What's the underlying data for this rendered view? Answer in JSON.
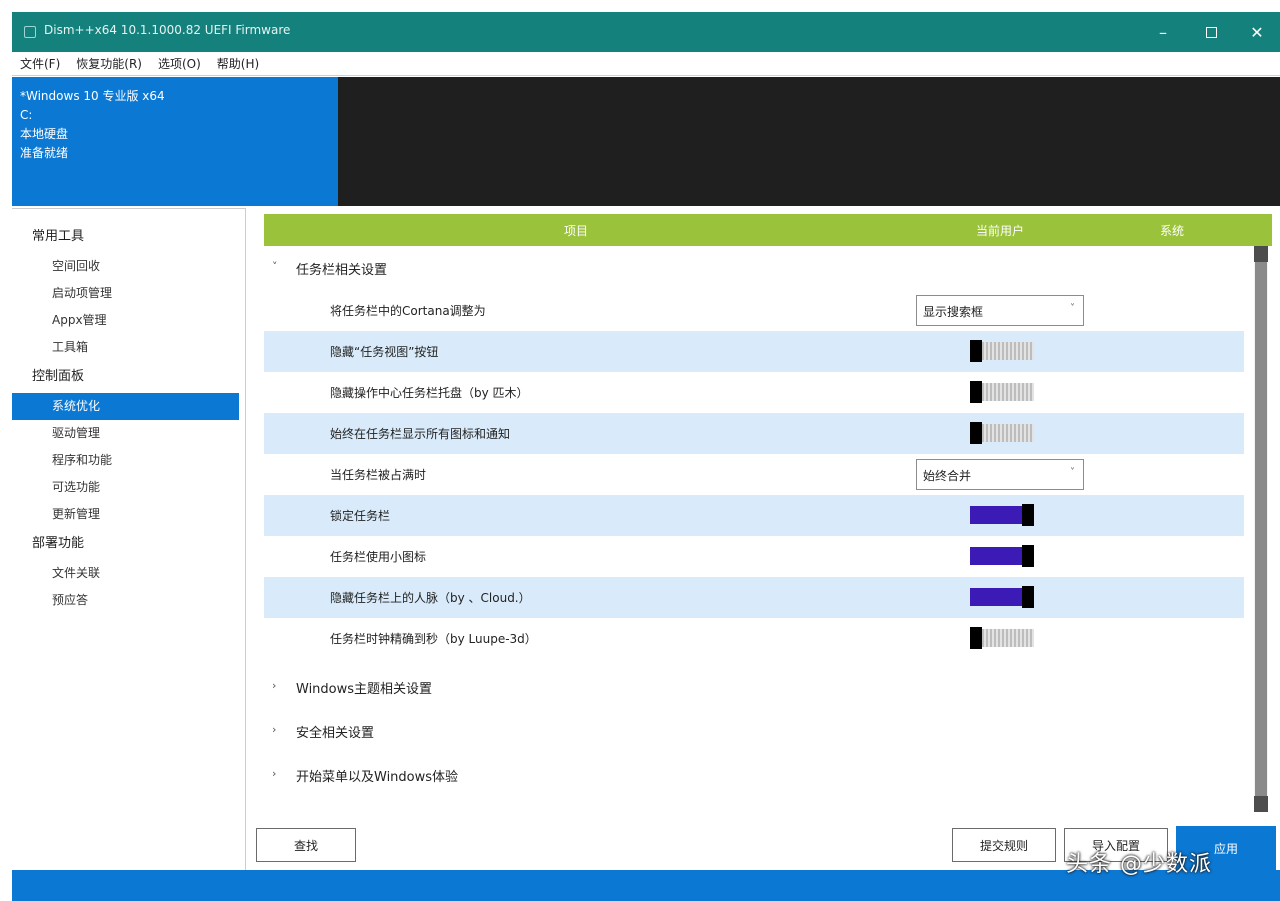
{
  "window": {
    "title": "Dism++x64 10.1.1000.82 UEFI Firmware",
    "minimize": "–",
    "close": "✕"
  },
  "menu": [
    "文件(F)",
    "恢复功能(R)",
    "选项(O)",
    "帮助(H)"
  ],
  "session": {
    "lines": [
      "*Windows 10 专业版 x64",
      "C:",
      "本地硬盘",
      "准备就绪"
    ]
  },
  "nav": [
    {
      "category": "常用工具",
      "items": [
        "空间回收",
        "启动项管理",
        "Appx管理",
        "工具箱"
      ]
    },
    {
      "category": "控制面板",
      "items": [
        "系统优化",
        "驱动管理",
        "程序和功能",
        "可选功能",
        "更新管理"
      ]
    },
    {
      "category": "部署功能",
      "items": [
        "文件关联",
        "预应答"
      ]
    }
  ],
  "nav_active": "系统优化",
  "table": {
    "headers": {
      "item": "项目",
      "current_user": "当前用户",
      "system": "系统"
    },
    "groups": [
      {
        "label": "任务栏相关设置",
        "expanded": true,
        "rows": [
          {
            "label": "将任务栏中的Cortana调整为",
            "control": "dropdown",
            "value": "显示搜索框"
          },
          {
            "label": "隐藏“任务视图”按钮",
            "control": "toggle",
            "state": "off"
          },
          {
            "label": "隐藏操作中心任务栏托盘（by 匹木）",
            "control": "toggle",
            "state": "off"
          },
          {
            "label": "始终在任务栏显示所有图标和通知",
            "control": "toggle",
            "state": "off"
          },
          {
            "label": "当任务栏被占满时",
            "control": "dropdown",
            "value": "始终合并"
          },
          {
            "label": "锁定任务栏",
            "control": "toggle",
            "state": "on"
          },
          {
            "label": "任务栏使用小图标",
            "control": "toggle",
            "state": "on"
          },
          {
            "label": "隐藏任务栏上的人脉（by 、Cloud.）",
            "control": "toggle",
            "state": "on"
          },
          {
            "label": "任务栏时钟精确到秒（by Luupe-3d）",
            "control": "toggle",
            "state": "off"
          }
        ]
      },
      {
        "label": "Windows主题相关设置",
        "expanded": false,
        "rows": []
      },
      {
        "label": "安全相关设置",
        "expanded": false,
        "rows": []
      },
      {
        "label": "开始菜单以及Windows体验",
        "expanded": false,
        "rows": []
      }
    ]
  },
  "buttons": {
    "search": "查找",
    "submit": "提交规则",
    "import": "导入配置",
    "apply": "应用"
  },
  "watermark": "头条 @少数派",
  "colors": {
    "titlebar": "#14817d",
    "accent": "#0b78d4",
    "header": "#9ac23a",
    "toggle_on": "#3b1ab5",
    "row_alt": "#d9ebfa"
  }
}
